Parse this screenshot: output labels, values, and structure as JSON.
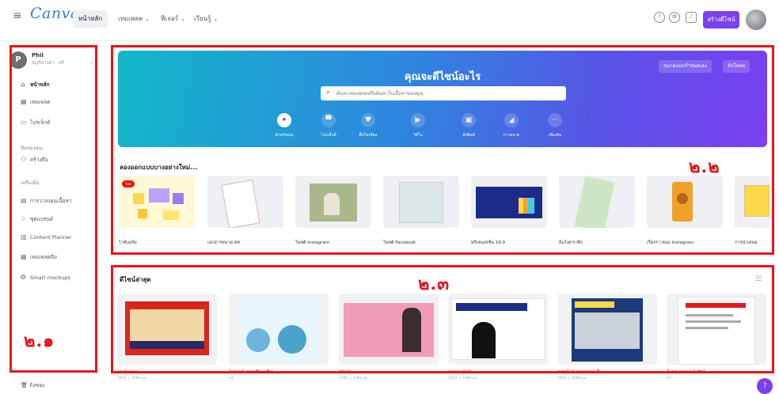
{
  "topbar": {
    "logo": "Canva",
    "nav": [
      {
        "label": "หน้าหลัก",
        "active": true,
        "dropdown": false
      },
      {
        "label": "เทมเพลต",
        "active": false,
        "dropdown": true
      },
      {
        "label": "ฟีเจอร์",
        "active": false,
        "dropdown": true
      },
      {
        "label": "เรียนรู้",
        "active": false,
        "dropdown": true
      }
    ],
    "create_label": "สร้างดีไซน์"
  },
  "sidebar": {
    "account_initial": "P",
    "account_name": "Phil",
    "account_sub": "บัญชีส่วนตัว · ฟรี",
    "items": [
      {
        "label": "หน้าหลัก",
        "icon": "home-icon",
        "glyph": "⌂",
        "active": true
      },
      {
        "label": "เทมเพลต",
        "icon": "template-icon",
        "glyph": "▦",
        "active": false
      },
      {
        "label": "โปรเจ็กต์",
        "icon": "folder-icon",
        "glyph": "▭",
        "active": false
      }
    ],
    "section1": "ทีมของคุณ",
    "team_items": [
      {
        "label": "สร้างทีม",
        "icon": "team-icon",
        "glyph": "⚇"
      }
    ],
    "section2": "เครื่องมือ",
    "tool_items": [
      {
        "label": "การวางแผนเนื้อหา",
        "icon": "calendar-icon",
        "glyph": "▤"
      },
      {
        "label": "ชุดแบรนด์",
        "icon": "brand-icon",
        "glyph": "♧"
      },
      {
        "label": "Content Planner",
        "icon": "planner-icon",
        "glyph": "▥"
      },
      {
        "label": "เทมเพลตทีม",
        "icon": "grid-icon",
        "glyph": "▦"
      },
      {
        "label": "Smart mockups",
        "icon": "mockup-icon",
        "glyph": "❂"
      }
    ],
    "trash_label": "ถังขยะ"
  },
  "labels": {
    "sidebar": "๒.๑",
    "templates": "๒.๒",
    "recent": "๒.๓"
  },
  "hero": {
    "title": "คุณจะดีไซน์อะไร",
    "custom_size": "ขนาดแบบกำหนดเอง",
    "upload": "อัปโหลด",
    "search_placeholder": "ค้นหาเทมเพลตหรือค้นหาในเนื้อหาของคุณ",
    "categories": [
      {
        "label": "สำหรับคุณ",
        "icon": "sparkle-icon",
        "glyph": "✦",
        "active": true
      },
      {
        "label": "โปรเจ็กต์",
        "icon": "presentation-icon",
        "glyph": "▀",
        "active": false
      },
      {
        "label": "สื่อโซเชียล",
        "icon": "heart-icon",
        "glyph": "♥",
        "active": false
      },
      {
        "label": "วิดีโอ",
        "icon": "video-icon",
        "glyph": "▶",
        "active": false
      },
      {
        "label": "สิ่งพิมพ์",
        "icon": "print-icon",
        "glyph": "▣",
        "active": false
      },
      {
        "label": "การตลาด",
        "icon": "megaphone-icon",
        "glyph": "◢",
        "active": false
      },
      {
        "label": "เพิ่มเติม",
        "icon": "more-icon",
        "glyph": "⋯",
        "active": false
      }
    ]
  },
  "templates": {
    "title": "ลองออกแบบบางอย่างใหม่...",
    "items": [
      {
        "label": "ไวท์บอร์ด",
        "badge": "ใหม่"
      },
      {
        "label": "เอกสารขนาด A4"
      },
      {
        "label": "โพสต์ Instagram"
      },
      {
        "label": "โพสต์ Facebook"
      },
      {
        "label": "พรีเซนเทชั่น 16:9"
      },
      {
        "label": "อินโฟกราฟิก"
      },
      {
        "label": "เรื่องราวของ Instagram"
      },
      {
        "label": "การนำเสนอ"
      }
    ]
  },
  "recent": {
    "title": "ดีไซน์ล่าสุด",
    "items": [
      {
        "name": "งานนำเสนอ",
        "sub": "1920 × 1080 px"
      },
      {
        "name": "โปสเตอร์ สถานที่ท่องเที่ยว",
        "sub": "A4"
      },
      {
        "name": "หน้าปก",
        "sub": "1080 × 1080 px"
      },
      {
        "name": "ภาพแนะนำตัว",
        "sub": "1920 × 1080 px"
      },
      {
        "name": "ภาพสไลด์ อาคารสถานที่",
        "sub": "1920 × 1080 px"
      },
      {
        "name": "ใบงาน รายการคำศัพท์",
        "sub": "A4"
      }
    ]
  },
  "colors": {
    "accent": "#7b3ff2",
    "highlight": "#e8141c",
    "hero_start": "#12b8c9",
    "hero_end": "#7b3ff2"
  }
}
